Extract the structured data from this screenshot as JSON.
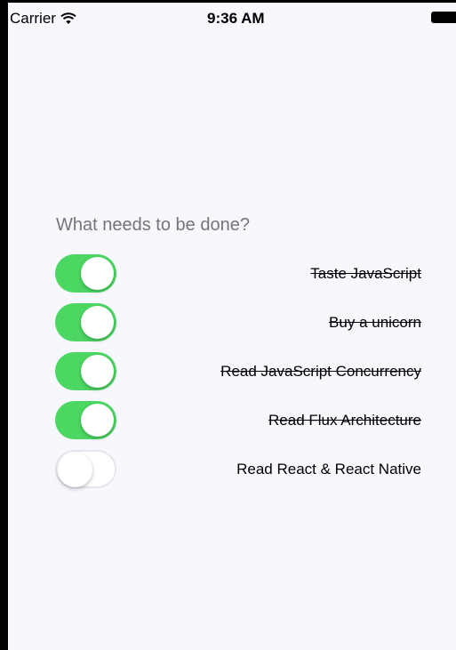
{
  "status_bar": {
    "carrier": "Carrier",
    "time": "9:36 AM",
    "wifi_icon": "wifi-icon",
    "battery_icon": "battery-icon"
  },
  "new_todo": {
    "placeholder": "What needs to be done?",
    "value": ""
  },
  "colors": {
    "toggle_on": "#4bd762",
    "toggle_off": "#ffffff",
    "background": "#f6f8fd"
  },
  "todos": [
    {
      "text": "Taste JavaScript",
      "completed": true
    },
    {
      "text": "Buy a unicorn",
      "completed": true
    },
    {
      "text": "Read JavaScript Concurrency",
      "completed": true
    },
    {
      "text": "Read Flux Architecture",
      "completed": true
    },
    {
      "text": "Read React & React Native",
      "completed": false
    }
  ]
}
